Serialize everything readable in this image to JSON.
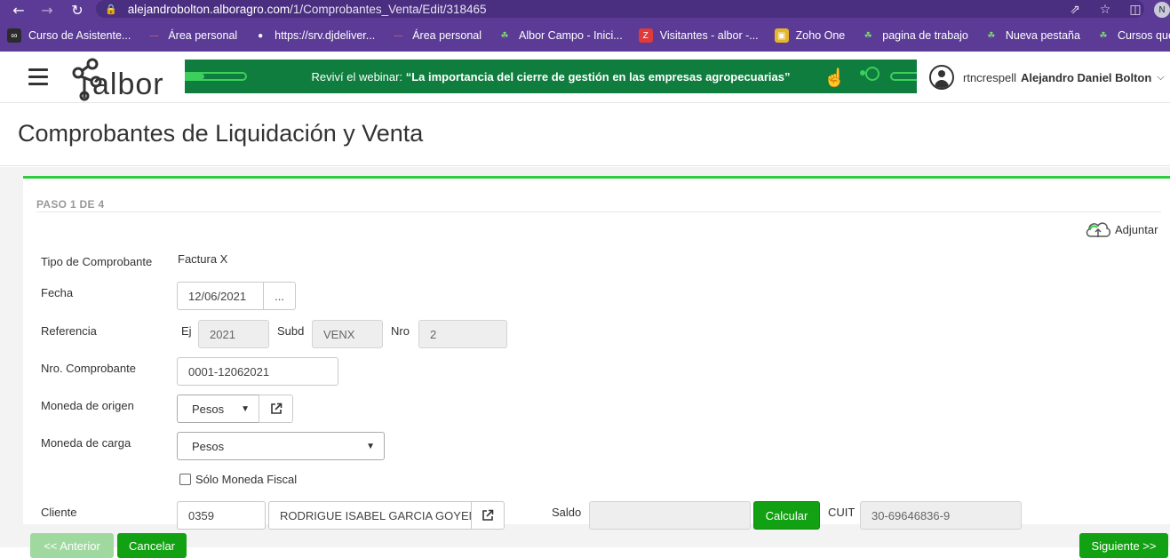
{
  "browser": {
    "url_domain": "alejandrobolton.alboragro.com",
    "url_path": "/1/Comprobantes_Venta/Edit/318465",
    "profile_initial": "N",
    "bookmarks": [
      {
        "label": "Curso de Asistente...",
        "icon": "infinity-icon",
        "color": "#2b2b2b"
      },
      {
        "label": "Área personal",
        "icon": "dash-icon",
        "color": "#b83a3a"
      },
      {
        "label": "https://srv.djdeliver...",
        "icon": "globe-icon",
        "color": "#5b3b96"
      },
      {
        "label": "Área personal",
        "icon": "dash-icon",
        "color": "#b83a3a"
      },
      {
        "label": "Albor Campo - Inici...",
        "icon": "sprout-icon",
        "color": "#5b3b96"
      },
      {
        "label": "Visitantes - albor -...",
        "icon": "z-icon",
        "color": "#e03a3a"
      },
      {
        "label": "Zoho One",
        "icon": "cube-icon",
        "color": "#e5b52a"
      },
      {
        "label": "pagina de trabajo",
        "icon": "sprout-icon",
        "color": "#5b3b96"
      },
      {
        "label": "Nueva pestaña",
        "icon": "sprout-icon",
        "color": "#5b3b96"
      },
      {
        "label": "Cursos que Recibo",
        "icon": "sprout-icon",
        "color": "#5b3b96"
      }
    ]
  },
  "header": {
    "logo_text": "albor",
    "banner_prefix": "Reviví el webinar: ",
    "banner_title": "“La importancia del cierre de gestión en las empresas agropecuarias”",
    "username": "rtncrespell",
    "fullname": "Alejandro Daniel Bolton"
  },
  "page": {
    "title": "Comprobantes de Liquidación y Venta"
  },
  "form": {
    "step": "PASO 1 DE 4",
    "attach_label": "Adjuntar",
    "labels": {
      "tipo": "Tipo de Comprobante",
      "fecha": "Fecha",
      "referencia": "Referencia",
      "nro_comprobante": "Nro. Comprobante",
      "moneda_origen": "Moneda de origen",
      "moneda_carga": "Moneda de carga",
      "solo_moneda_fiscal": "Sólo Moneda Fiscal",
      "cliente": "Cliente",
      "ej": "Ej",
      "subd": "Subd",
      "nro": "Nro",
      "saldo": "Saldo",
      "cuit": "CUIT"
    },
    "values": {
      "tipo": "Factura X",
      "fecha": "12/06/2021",
      "fecha_btn": "...",
      "ej": "2021",
      "subd": "VENX",
      "nro": "2",
      "nro_comprobante": "0001-12062021",
      "moneda_origen": "Pesos",
      "moneda_carga": "Pesos",
      "cliente_codigo": "0359",
      "cliente_nombre": "RODRIGUE ISABEL GARCIA GOYEN",
      "saldo": "",
      "cuit": "30-69646836-9"
    },
    "calcular_label": "Calcular"
  },
  "footer": {
    "anterior": "<< Anterior",
    "cancelar": "Cancelar",
    "siguiente": "Siguiente >>"
  },
  "colors": {
    "browser_purple": "#5b3b96",
    "accent_green": "#2ecc40",
    "button_green": "#12a112",
    "banner_green": "#0f7d3e"
  }
}
